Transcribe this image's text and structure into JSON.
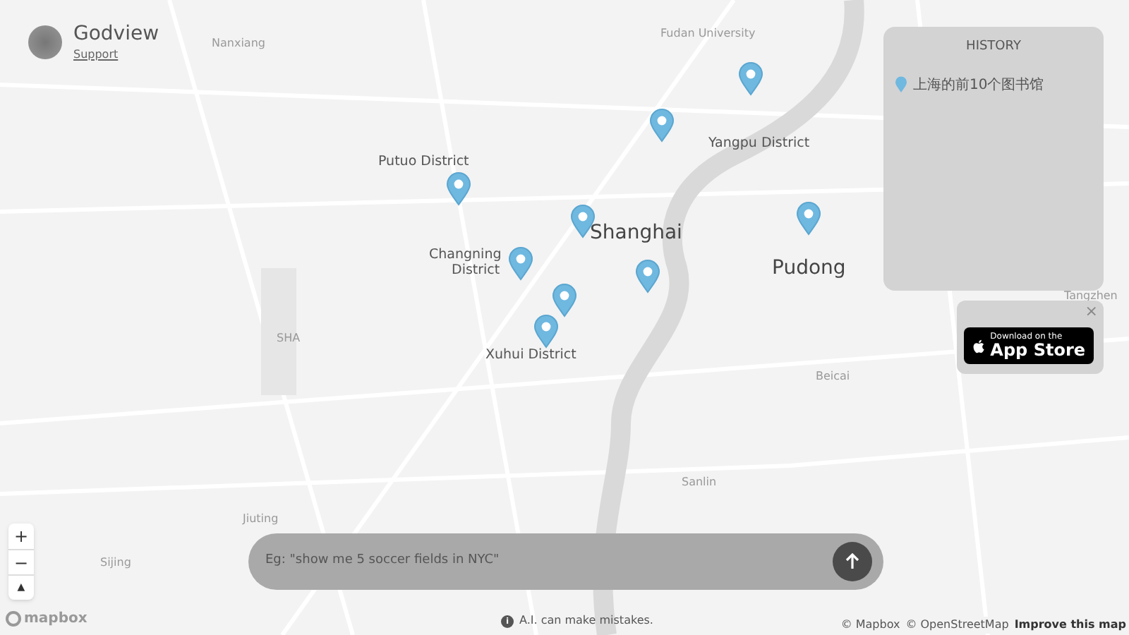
{
  "brand": {
    "title": "Godview",
    "link": "Support"
  },
  "map": {
    "labels": [
      {
        "text": "Nanxiang",
        "kind": "minor"
      },
      {
        "text": "Fudan University",
        "kind": "minor"
      },
      {
        "text": "Yangpu District",
        "kind": "district"
      },
      {
        "text": "Putuo District",
        "kind": "district"
      },
      {
        "text": "Shanghai",
        "kind": "city"
      },
      {
        "text": "Changning",
        "kind": "district"
      },
      {
        "text": "District",
        "kind": "district"
      },
      {
        "text": "Pudong",
        "kind": "city"
      },
      {
        "text": "Xuhui District",
        "kind": "district"
      },
      {
        "text": "SHA",
        "kind": "minor"
      },
      {
        "text": "Beicai",
        "kind": "minor"
      },
      {
        "text": "Tangzhen",
        "kind": "minor"
      },
      {
        "text": "Jiuting",
        "kind": "minor"
      },
      {
        "text": "Sijing",
        "kind": "minor"
      },
      {
        "text": "Sanlin",
        "kind": "minor"
      }
    ]
  },
  "history": {
    "title": "HISTORY",
    "items": [
      "上海的前10个图书馆"
    ]
  },
  "app_store": {
    "close": "×",
    "line1": "Download on the",
    "line2": "App Store"
  },
  "zoom_controls": {
    "zoom_in": "+",
    "zoom_out": "−",
    "compass": "▲"
  },
  "search": {
    "placeholder": "Eg: \"show me 5 soccer fields in NYC\""
  },
  "disclaimer": {
    "icon": "i",
    "text": "A.I. can make mistakes."
  },
  "mapbox_logo": "mapbox",
  "attribution": {
    "items": [
      "© Mapbox",
      "© OpenStreetMap"
    ],
    "improve": "Improve this map"
  }
}
